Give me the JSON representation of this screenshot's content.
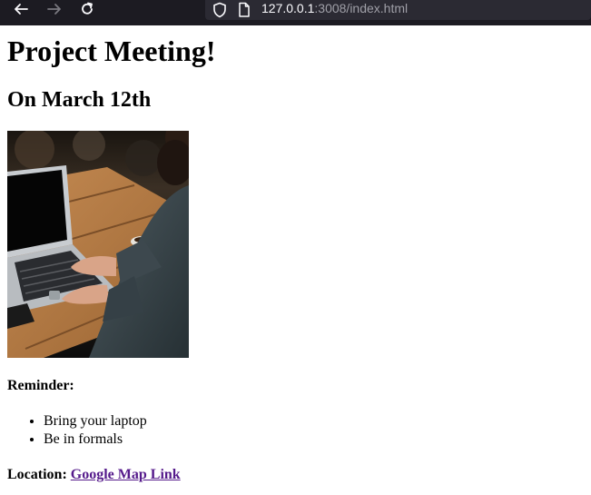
{
  "browser": {
    "url_host": "127.0.0.1",
    "url_rest": ":3008/index.html",
    "icons": [
      "back-arrow-icon",
      "forward-arrow-icon",
      "reload-icon",
      "shield-icon",
      "page-icon"
    ]
  },
  "page": {
    "title": "Project Meeting!",
    "subtitle": "On March 12th",
    "reminder_heading": "Reminder:",
    "reminders": [
      "Bring your laptop",
      "Be in formals"
    ],
    "location_label": "Location:",
    "location_link": "Google Map Link",
    "link_color": "#551a8b"
  }
}
